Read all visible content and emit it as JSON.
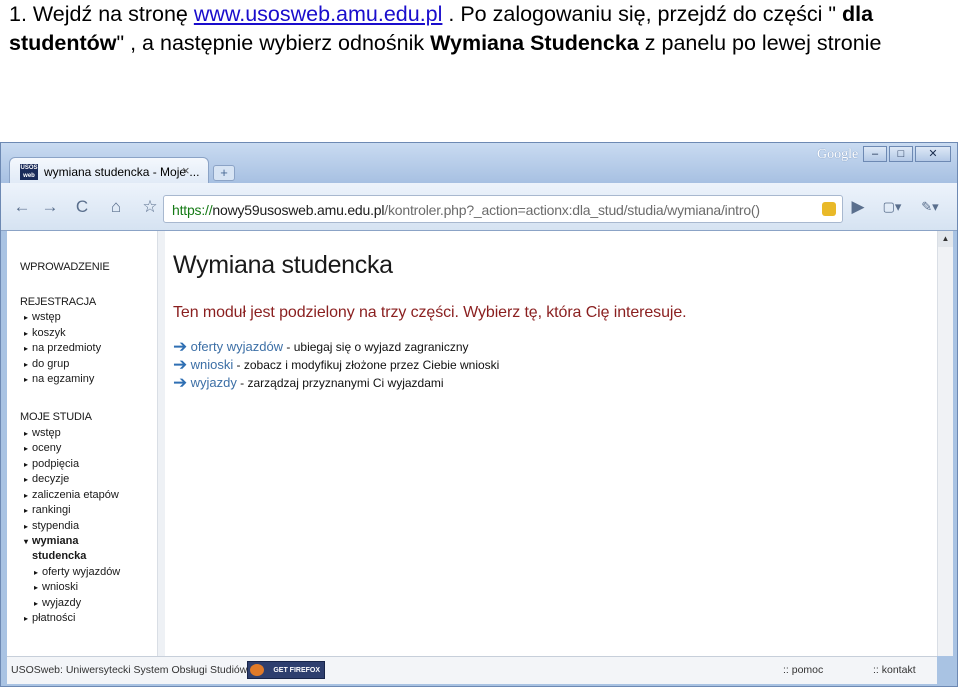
{
  "instruction": {
    "part1": "1. Wejdź na stronę ",
    "link": "www.usosweb.amu.edu.pl",
    "part2": " . Po zalogowaniu się, przejdź do części \" ",
    "bold1": "dla studentów",
    "part3": "\" , a następnie wybierz odnośnik ",
    "bold2": "Wymiana Studencka",
    "part4": " z panelu po lewej stronie"
  },
  "browser": {
    "tab_title": "wymiana studencka - Moje ...",
    "tab_icon_text": "USOS web",
    "tab_close": "×",
    "new_tab": "+",
    "brand": "Google",
    "url_scheme": "https://",
    "url_host": "nowy59usosweb.amu.edu.pl",
    "url_path": "/kontroler.php?_action=actionx:dla_stud/studia/wymiana/intro()",
    "win_min": "–",
    "win_max": "□",
    "win_close": "✕",
    "back": "←",
    "forward": "→",
    "reload": "C",
    "home": "⌂",
    "star": "☆",
    "go": "▶",
    "page_menu": "▢▾",
    "tools_menu": "✎▾"
  },
  "sidebar": {
    "intro": "WPROWADZENIE",
    "registration": {
      "header": "REJESTRACJA",
      "items": [
        "wstęp",
        "koszyk",
        "na przedmioty",
        "do grup",
        "na egzaminy"
      ]
    },
    "studies": {
      "header": "MOJE STUDIA",
      "items": [
        "wstęp",
        "oceny",
        "podpięcia",
        "decyzje",
        "zaliczenia etapów",
        "rankingi",
        "stypendia"
      ],
      "active_line1": "wymiana",
      "active_line2": "studencka",
      "sub_items": [
        "oferty wyjazdów",
        "wnioski",
        "wyjazdy"
      ],
      "last_item": "płatności"
    },
    "tri": "▸",
    "tri_open": "▾"
  },
  "main": {
    "title": "Wymiana studencka",
    "lead": "Ten moduł jest podzielony na trzy części. Wybierz tę, która Cię interesuje.",
    "arrow": "➔",
    "links": [
      {
        "label": "oferty wyjazdów",
        "desc": " - ubiegaj się o wyjazd zagraniczny"
      },
      {
        "label": "wnioski",
        "desc": " - zobacz i modyfikuj złożone przez Ciebie wnioski"
      },
      {
        "label": "wyjazdy",
        "desc": " - zarządzaj przyznanymi Ci wyjazdami"
      }
    ]
  },
  "status": {
    "left": "USOSweb: Uniwersytecki System Obsługi Studiów",
    "firefox": "GET FIREFOX",
    "pomoc": ":: pomoc",
    "kontakt": ":: kontakt"
  },
  "scroll_up": "▲"
}
